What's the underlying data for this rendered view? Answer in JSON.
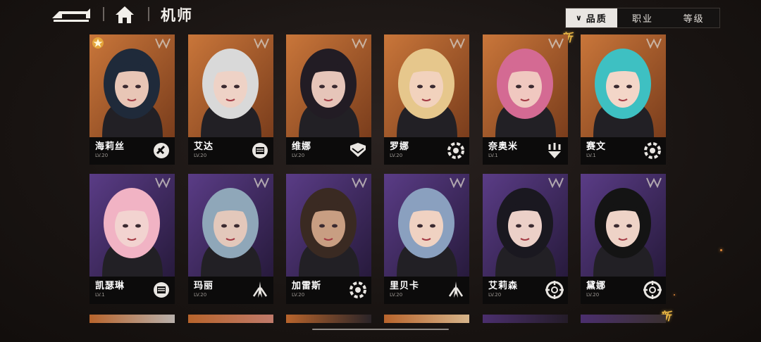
{
  "header": {
    "title": "机师",
    "back_icon": "back-arrow-icon",
    "home_icon": "home-icon"
  },
  "filters": {
    "tabs": [
      {
        "label": "品质",
        "active": true,
        "indicator": "∨"
      },
      {
        "label": "职业",
        "active": false
      },
      {
        "label": "等级",
        "active": false
      }
    ]
  },
  "badges": {
    "new_label": "新"
  },
  "colors": {
    "orange_bg": "#b8642c",
    "purple_bg": "#4b2f6e",
    "accent_gold": "#e9b545",
    "card_info_bg": "#0c0b0b"
  },
  "pilots": [
    {
      "name": "海莉丝",
      "level": "LV.20",
      "role_icon": "rifle-role-icon",
      "bg": "orange",
      "featured": true,
      "hair": "#1f2a3a",
      "skin": "#e8c6b6"
    },
    {
      "name": "艾达",
      "level": "LV.20",
      "role_icon": "fist-role-icon",
      "bg": "orange",
      "hair": "#d9d9d9",
      "skin": "#eed2c6"
    },
    {
      "name": "维娜",
      "level": "LV.20",
      "role_icon": "shield-role-icon",
      "bg": "orange",
      "hair": "#221c24",
      "skin": "#e6c5b9"
    },
    {
      "name": "罗娜",
      "level": "LV.20",
      "role_icon": "wrench-role-icon",
      "bg": "orange",
      "hair": "#e6c78c",
      "skin": "#f2d2bd"
    },
    {
      "name": "奈奥米",
      "level": "LV.1",
      "role_icon": "drone-role-icon",
      "bg": "orange",
      "hair": "#d46a93",
      "skin": "#f0c8c0"
    },
    {
      "name": "赛文",
      "level": "LV.1",
      "role_icon": "wrench-role-icon",
      "bg": "orange",
      "hair": "#3ec0c2",
      "skin": "#f3d6c8"
    },
    {
      "name": "凯瑟琳",
      "level": "LV.1",
      "role_icon": "fist-role-icon",
      "bg": "purple",
      "hair": "#f1b3c4",
      "skin": "#f2d3d0"
    },
    {
      "name": "玛丽",
      "level": "LV.20",
      "role_icon": "blade-role-icon",
      "bg": "purple",
      "hair": "#8fa7b9",
      "skin": "#e3c8bb"
    },
    {
      "name": "加雷斯",
      "level": "LV.20",
      "role_icon": "wrench-role-icon",
      "bg": "purple",
      "hair": "#3a2a22",
      "skin": "#c89e82"
    },
    {
      "name": "里贝卡",
      "level": "LV.20",
      "role_icon": "blade-role-icon",
      "bg": "purple",
      "hair": "#8aa0bf",
      "skin": "#f0d2c2"
    },
    {
      "name": "艾莉森",
      "level": "LV.20",
      "role_icon": "target-role-icon",
      "bg": "purple",
      "hair": "#1a1820",
      "skin": "#ecd0c8"
    },
    {
      "name": "黛娜",
      "level": "LV.20",
      "role_icon": "target-role-icon",
      "bg": "purple",
      "hair": "#141414",
      "skin": "#eed3c7"
    }
  ],
  "partial_row": [
    "card-13",
    "card-14",
    "card-15",
    "card-16",
    "card-17",
    "card-18"
  ]
}
